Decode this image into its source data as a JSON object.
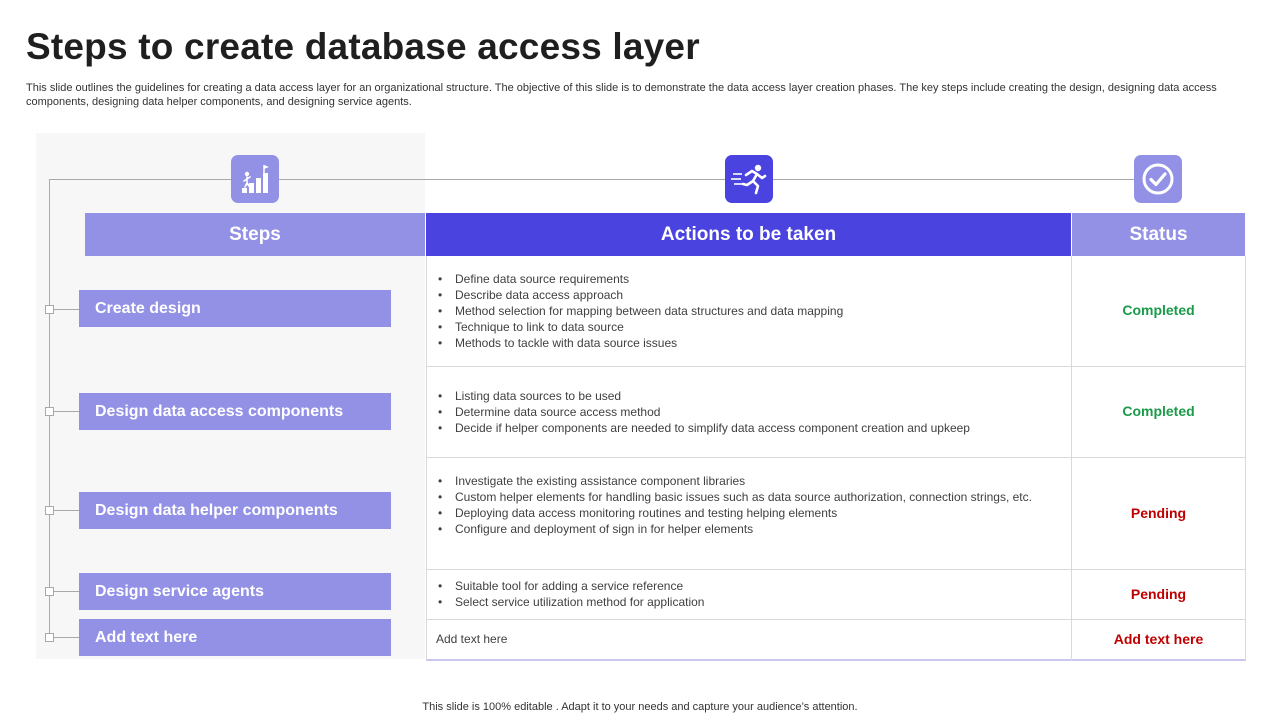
{
  "title": "Steps to create database access layer",
  "subtitle": "This slide outlines the guidelines for creating a data access layer for an organizational structure. The objective of this slide is to demonstrate the data access layer creation phases. The key steps include creating the design, designing data access components, designing data helper components, and designing service agents.",
  "headers": {
    "steps": "Steps",
    "actions": "Actions to be taken",
    "status": "Status"
  },
  "icons": {
    "steps": "stairs-progress-icon",
    "actions": "running-person-icon",
    "status": "checkmark-circle-icon"
  },
  "colors": {
    "accent_light": "#9391e6",
    "accent_dark": "#4a43e0",
    "status_completed": "#1a9b4a",
    "status_pending": "#c00000"
  },
  "rows": [
    {
      "step": "Create design",
      "actions": [
        "Define data source requirements",
        "Describe data access approach",
        "Method selection for mapping between data structures and data mapping",
        "Technique to link to data source",
        "Methods to tackle with data source issues"
      ],
      "status": "Completed"
    },
    {
      "step": "Design data access components",
      "actions": [
        "Listing data sources to be used",
        "Determine data source access method",
        "Decide if helper components are needed to simplify data access component creation and upkeep"
      ],
      "status": "Completed"
    },
    {
      "step": "Design data helper components",
      "actions": [
        "Investigate the existing assistance component libraries",
        "Custom helper elements for handling basic issues such as data source authorization, connection strings, etc.",
        "Deploying data access monitoring routines and testing helping elements",
        "Configure and deployment of sign in for helper elements"
      ],
      "status": "Pending"
    },
    {
      "step": "Design service agents",
      "actions": [
        "Suitable tool for adding a service reference",
        "Select service utilization method for application"
      ],
      "status": "Pending"
    },
    {
      "step": "Add text here",
      "action_text": "Add text here",
      "status": "Add text here"
    }
  ],
  "footer": "This slide is 100% editable . Adapt it to your needs and capture your audience’s attention."
}
